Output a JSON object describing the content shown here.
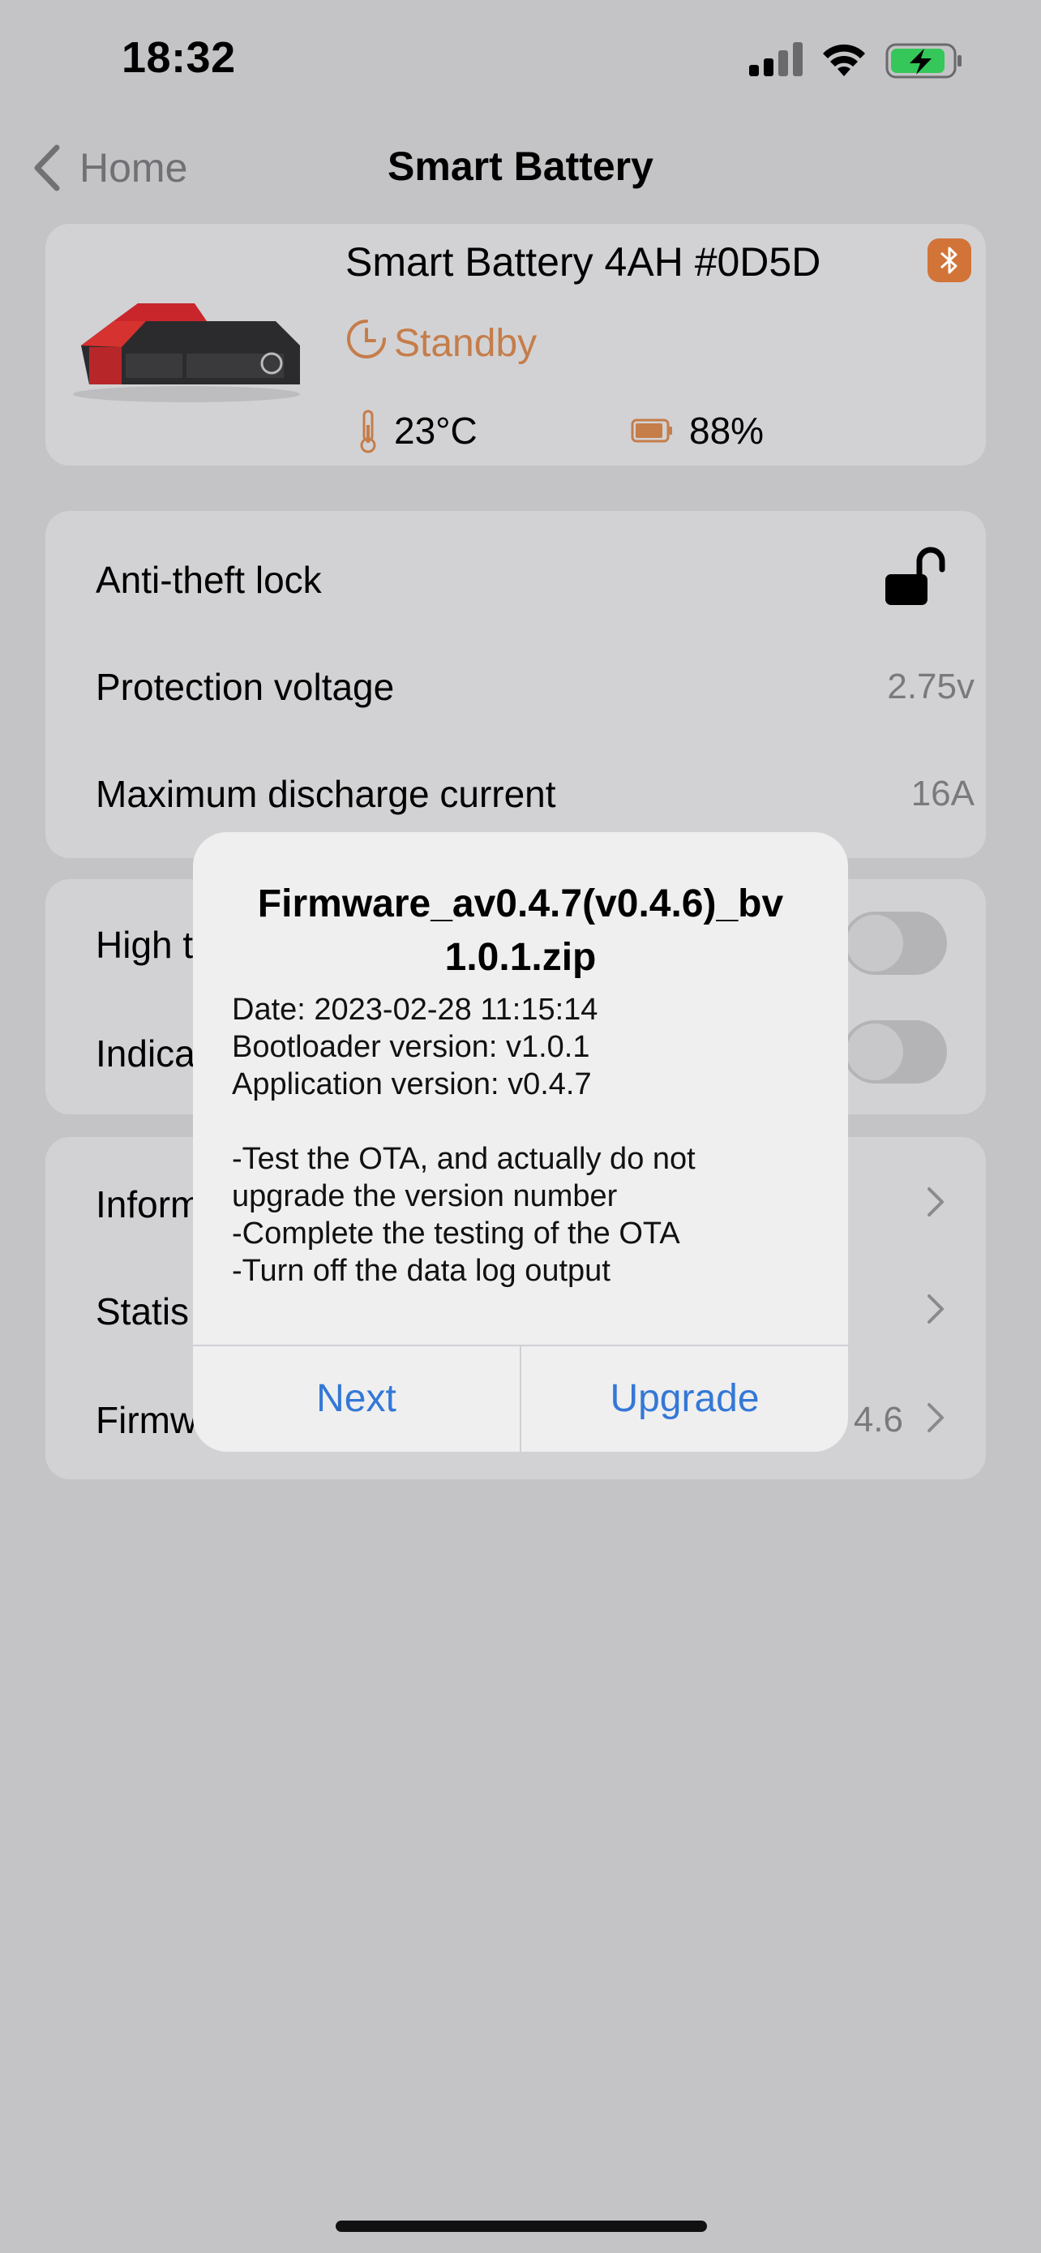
{
  "status_bar": {
    "time": "18:32"
  },
  "nav": {
    "back_label": "Home",
    "title": "Smart Battery"
  },
  "device": {
    "name": "Smart Battery 4AH #0D5D",
    "state": "Standby",
    "temperature": "23°C",
    "battery_level": "88%",
    "accent_color": "#d27438"
  },
  "settings": {
    "anti_theft_label": "Anti-theft lock",
    "protection_voltage_label": "Protection voltage",
    "protection_voltage_value": "2.75v",
    "max_discharge_label": "Maximum discharge current",
    "max_discharge_value": "16A"
  },
  "toggles": [
    {
      "label": "High t"
    },
    {
      "label": "Indica"
    }
  ],
  "menu": [
    {
      "label": "Inform"
    },
    {
      "label": "Statis"
    },
    {
      "label": "Firmw",
      "value": "4.6"
    }
  ],
  "dialog": {
    "title": "Firmware_av0.4.7(v0.4.6)_bv\n1.0.1.zip",
    "body": "Date: 2023-02-28 11:15:14\nBootloader version: v1.0.1\nApplication version: v0.4.7\n\n-Test the OTA, and actually do not\nupgrade the version number\n-Complete the testing of the OTA\n-Turn off the data log output",
    "next_label": "Next",
    "upgrade_label": "Upgrade"
  }
}
